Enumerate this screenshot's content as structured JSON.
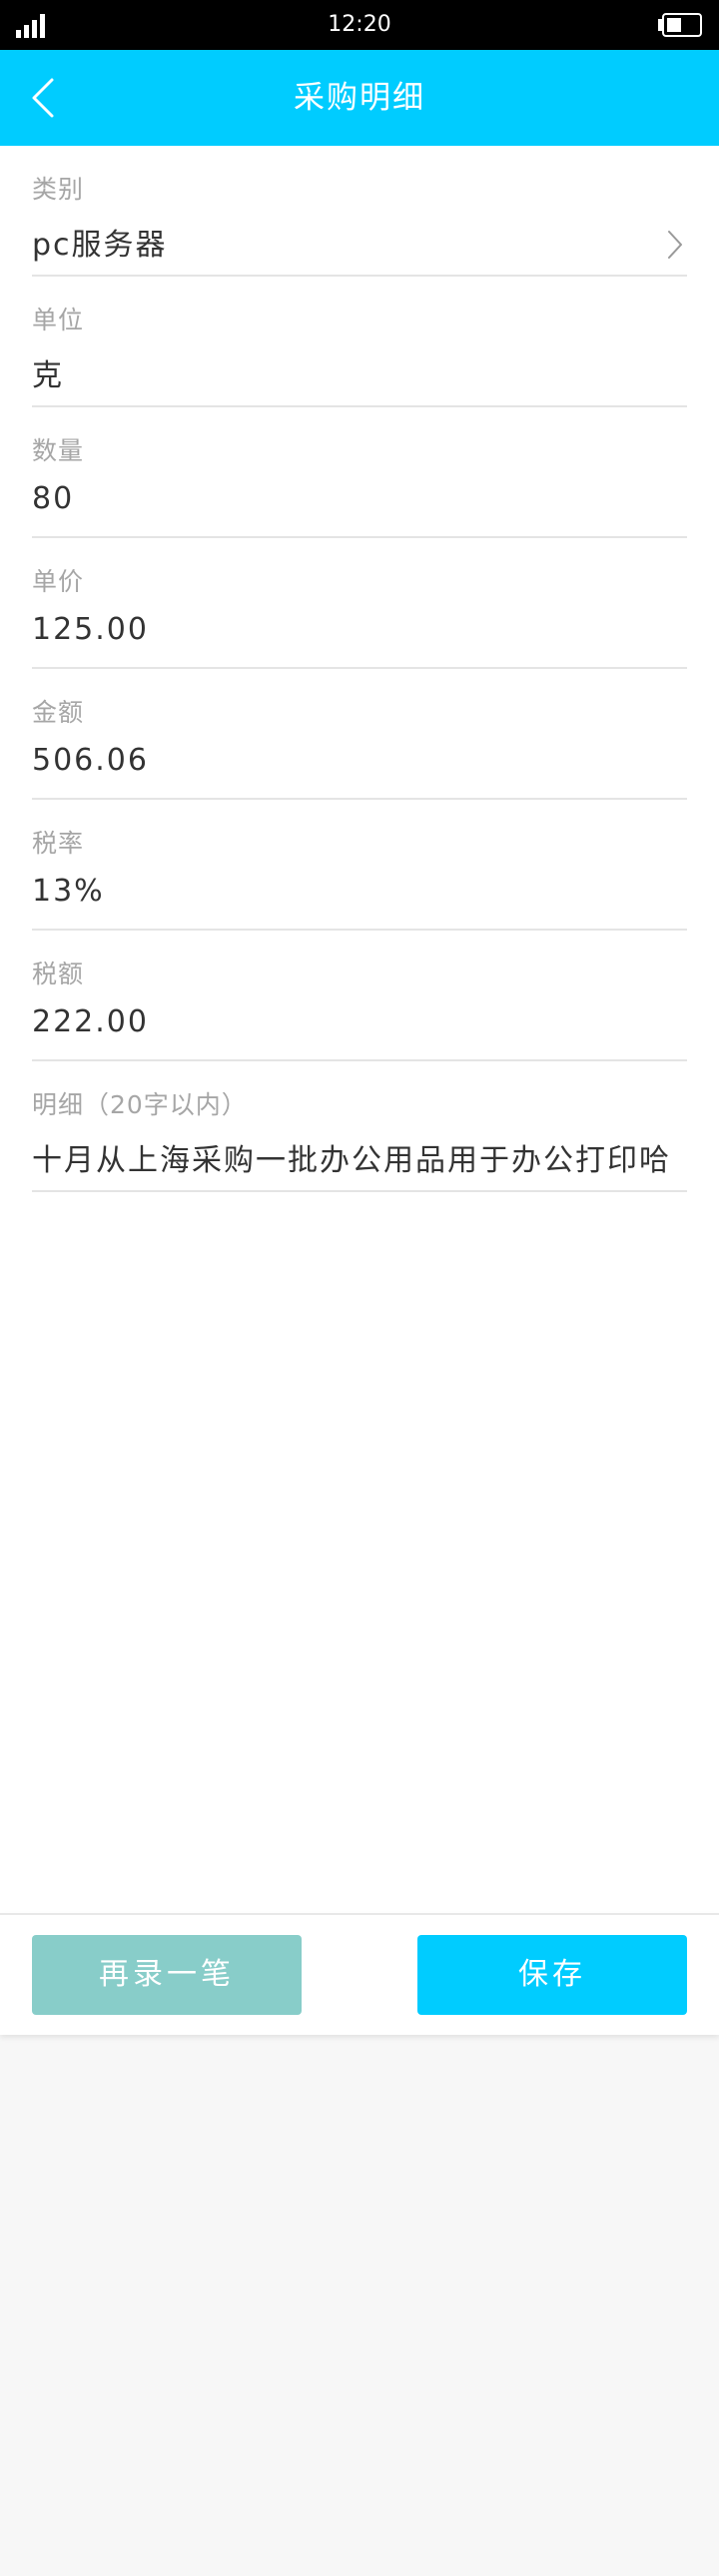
{
  "status_bar": {
    "time": "12:20"
  },
  "header": {
    "title": "采购明细"
  },
  "fields": [
    {
      "label": "类别",
      "value": "pc服务器"
    },
    {
      "label": "单位",
      "value": "克"
    },
    {
      "label": "数量",
      "value": "80"
    },
    {
      "label": "单价",
      "value": "125.00"
    },
    {
      "label": "金额",
      "value": "506.06"
    },
    {
      "label": "税率",
      "value": "13%"
    },
    {
      "label": "税额",
      "value": "222.00"
    },
    {
      "label": "明细（20字以内）",
      "value": "十月从上海采购一批办公用品用于办公打印哈"
    }
  ],
  "buttons": {
    "again_label": "再录一笔",
    "save_label": "保存"
  },
  "colors": {
    "header": "#00ccff",
    "save_button": "#00ccff",
    "again_button": "#88cdc9"
  },
  "icons": [
    "signal-icon",
    "battery-icon",
    "back-arrow-icon",
    "chevron-right-icon"
  ]
}
